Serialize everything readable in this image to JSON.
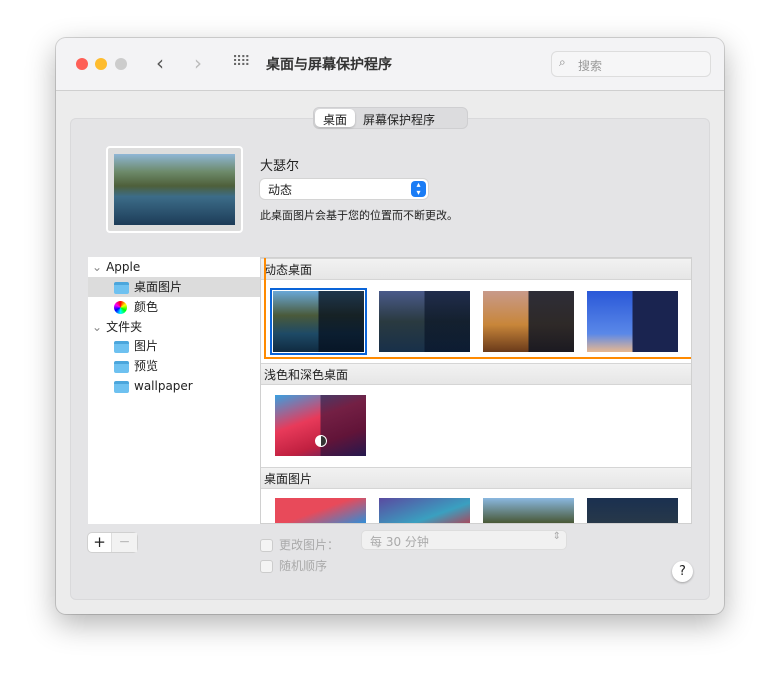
{
  "window": {
    "title": "桌面与屏幕保护程序",
    "search_placeholder": "搜索"
  },
  "tabs": [
    {
      "label": "桌面",
      "selected": true
    },
    {
      "label": "屏幕保护程序",
      "selected": false
    }
  ],
  "current": {
    "name": "大瑟尔",
    "mode": "动态",
    "description": "此桌面图片会基于您的位置而不断更改。"
  },
  "sidebar": {
    "groups": [
      {
        "label": "Apple",
        "items": [
          {
            "label": "桌面图片",
            "selected": true
          },
          {
            "label": "颜色"
          }
        ]
      },
      {
        "label": "文件夹",
        "items": [
          {
            "label": "图片"
          },
          {
            "label": "预览"
          },
          {
            "label": "wallpaper"
          }
        ]
      }
    ]
  },
  "sections": [
    {
      "title": "动态桌面"
    },
    {
      "title": "浅色和深色桌面"
    },
    {
      "title": "桌面图片"
    }
  ],
  "bottom": {
    "add": "+",
    "remove": "−",
    "change_picture": "更改图片：",
    "interval": "每 30 分钟",
    "random_order": "随机顺序",
    "help": "?"
  },
  "colors": {
    "highlight": "#ff8a00",
    "selection": "#0a64d8"
  }
}
